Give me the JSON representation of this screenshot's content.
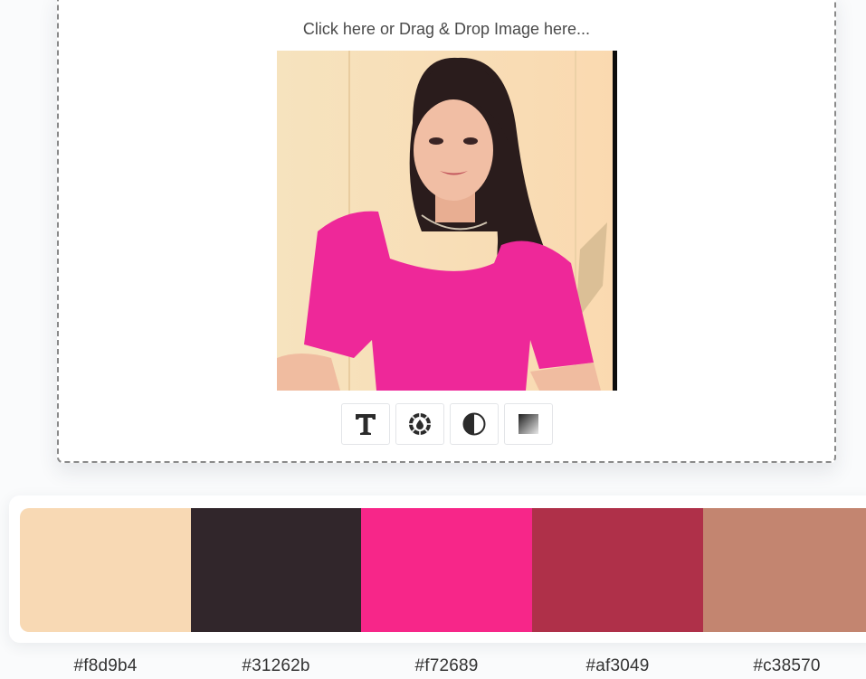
{
  "upload": {
    "hint": "Click here or Drag & Drop Image here..."
  },
  "toolbar": {
    "tools": [
      {
        "icon": "text-icon"
      },
      {
        "icon": "color-wheel-icon"
      },
      {
        "icon": "contrast-icon"
      },
      {
        "icon": "gradient-icon"
      }
    ]
  },
  "palette": {
    "swatches": [
      {
        "hex": "#f8d9b4",
        "label": "#f8d9b4"
      },
      {
        "hex": "#31262b",
        "label": "#31262b"
      },
      {
        "hex": "#f72689",
        "label": "#f72689"
      },
      {
        "hex": "#af3049",
        "label": "#af3049"
      },
      {
        "hex": "#c38570",
        "label": "#c38570"
      }
    ]
  }
}
